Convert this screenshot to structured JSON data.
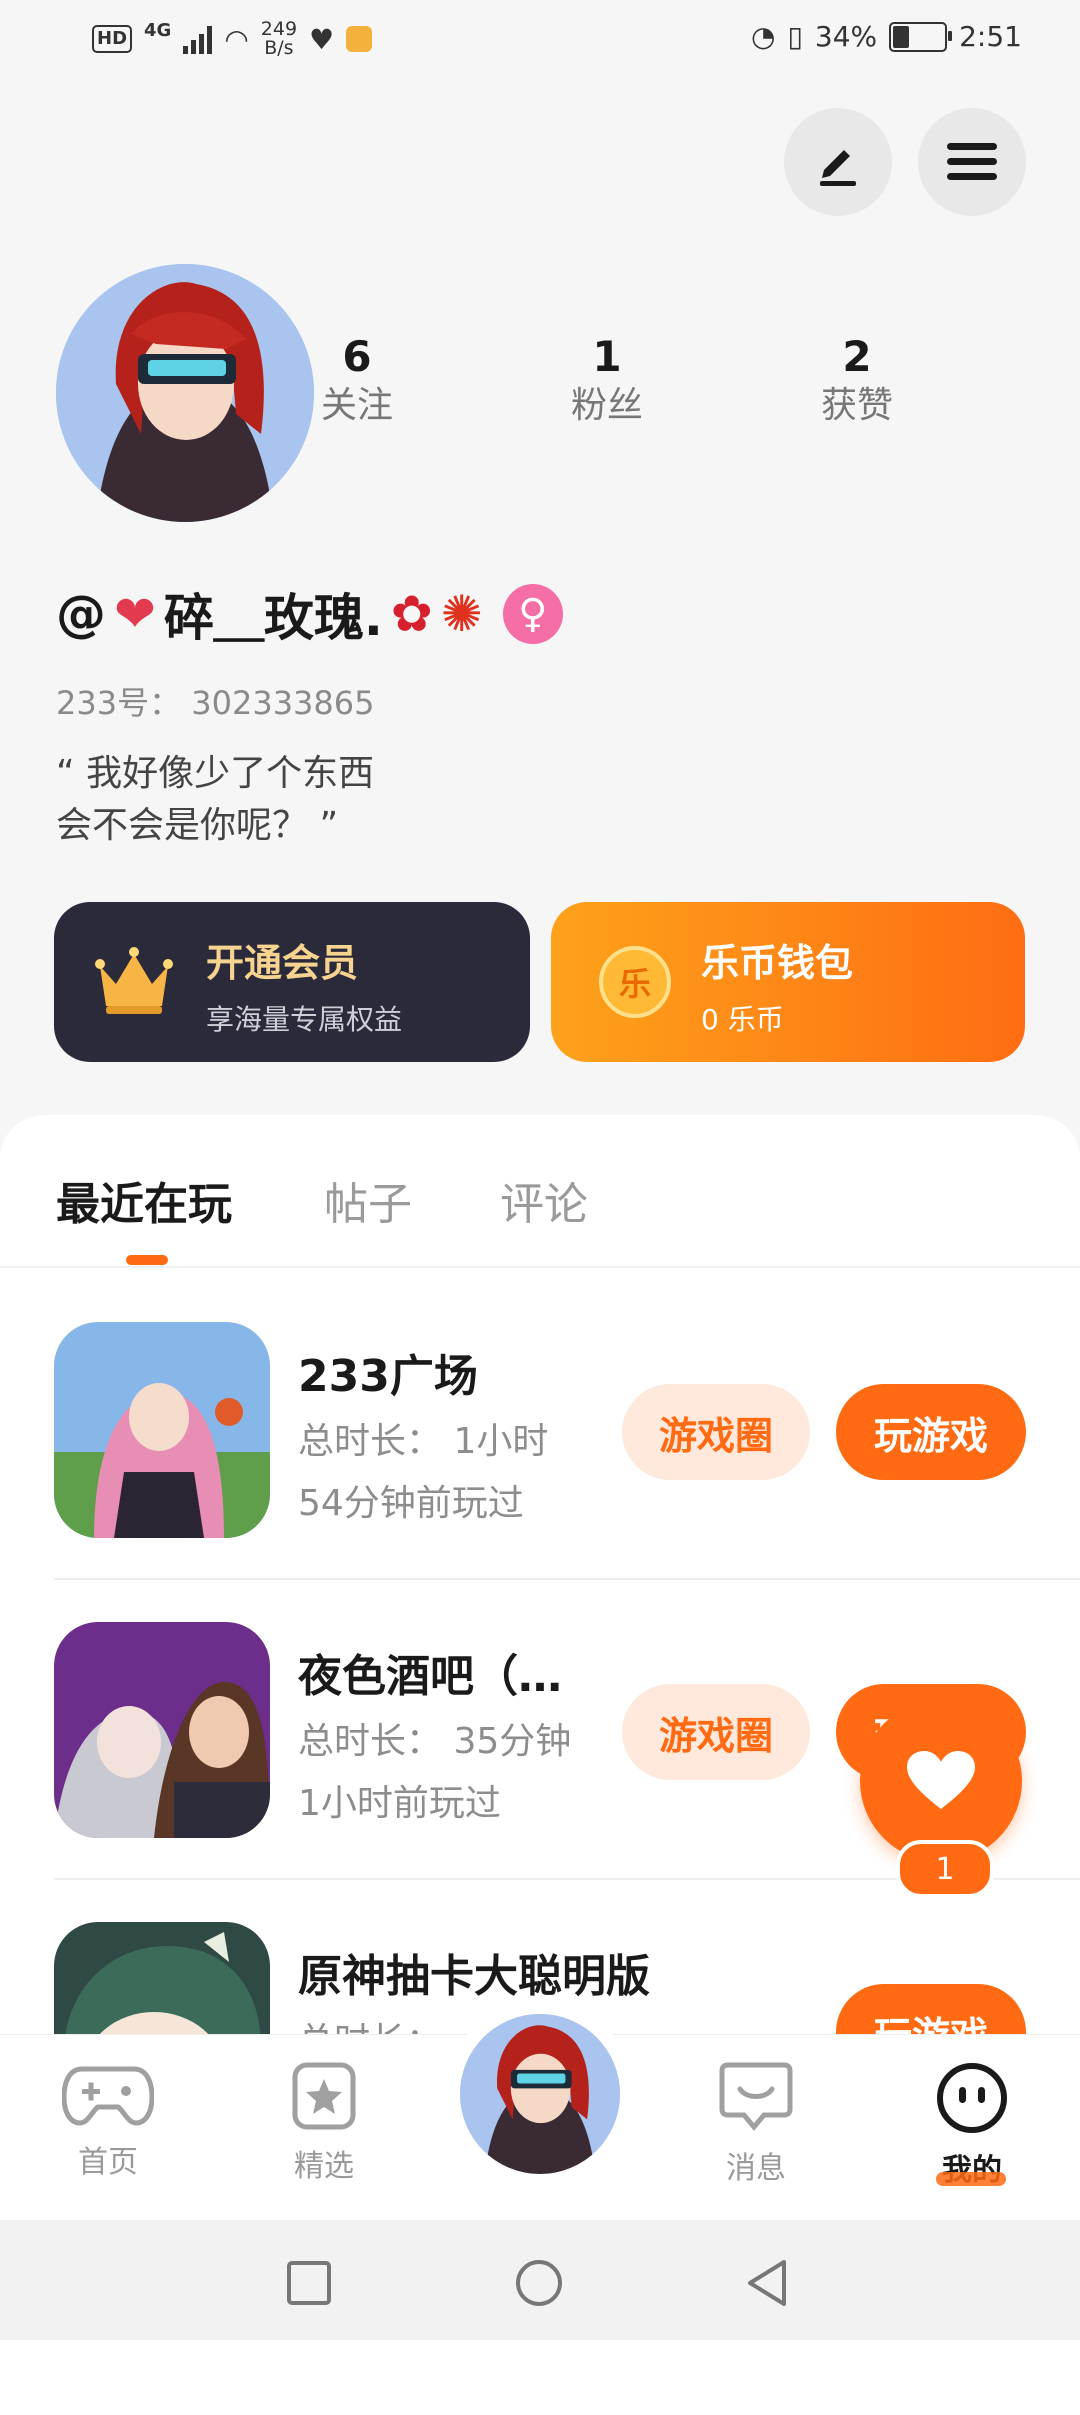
{
  "status_bar": {
    "left": {
      "hd": "HD",
      "network": "4G",
      "net_speed_value": "249",
      "net_speed_unit": "B/s"
    },
    "right": {
      "battery": "34%",
      "time": "2:51"
    }
  },
  "profile": {
    "stats": [
      {
        "value": "6",
        "label": "关注"
      },
      {
        "value": "1",
        "label": "粉丝"
      },
      {
        "value": "2",
        "label": "获赞"
      }
    ],
    "nickname_prefix": "@",
    "nickname": "碎＿玫瑰.",
    "gender_symbol": "♀",
    "uid": "233号： 302333865",
    "bio_line1": "“ 我好像少了个东西",
    "bio_line2": "会不会是你呢？ ”"
  },
  "cards": {
    "vip": {
      "title": "开通会员",
      "subtitle": "享海量专属权益"
    },
    "wallet": {
      "coin_glyph": "乐",
      "title": "乐币钱包",
      "subtitle": "0 乐币"
    }
  },
  "tabs": [
    "最近在玩",
    "帖子",
    "评论"
  ],
  "games": [
    {
      "title": "233广场",
      "duration": "总时长： 1小时",
      "last_played": "54分钟前玩过",
      "circle_btn": "游戏圈",
      "play_btn": "玩游戏"
    },
    {
      "title": "夜色酒吧（…",
      "duration": "总时长： 35分钟",
      "last_played": "1小时前玩过",
      "circle_btn": "游戏圈",
      "play_btn": "玩游戏"
    },
    {
      "title": "原神抽卡大聪明版",
      "duration": "总时长：",
      "play_btn": "玩游戏"
    }
  ],
  "floating": {
    "badge": "1"
  },
  "bottom_nav": [
    {
      "label": "首页",
      "icon": "gamepad-icon"
    },
    {
      "label": "精选",
      "icon": "star-bookmark-icon"
    },
    {
      "label": "",
      "icon": "avatar"
    },
    {
      "label": "消息",
      "icon": "chat-icon"
    },
    {
      "label": "我的",
      "icon": "smiley-icon"
    }
  ],
  "colors": {
    "accent": "#ff6a13",
    "vip_bg": "#2b2a3a",
    "vip_text": "#f6d38f"
  }
}
